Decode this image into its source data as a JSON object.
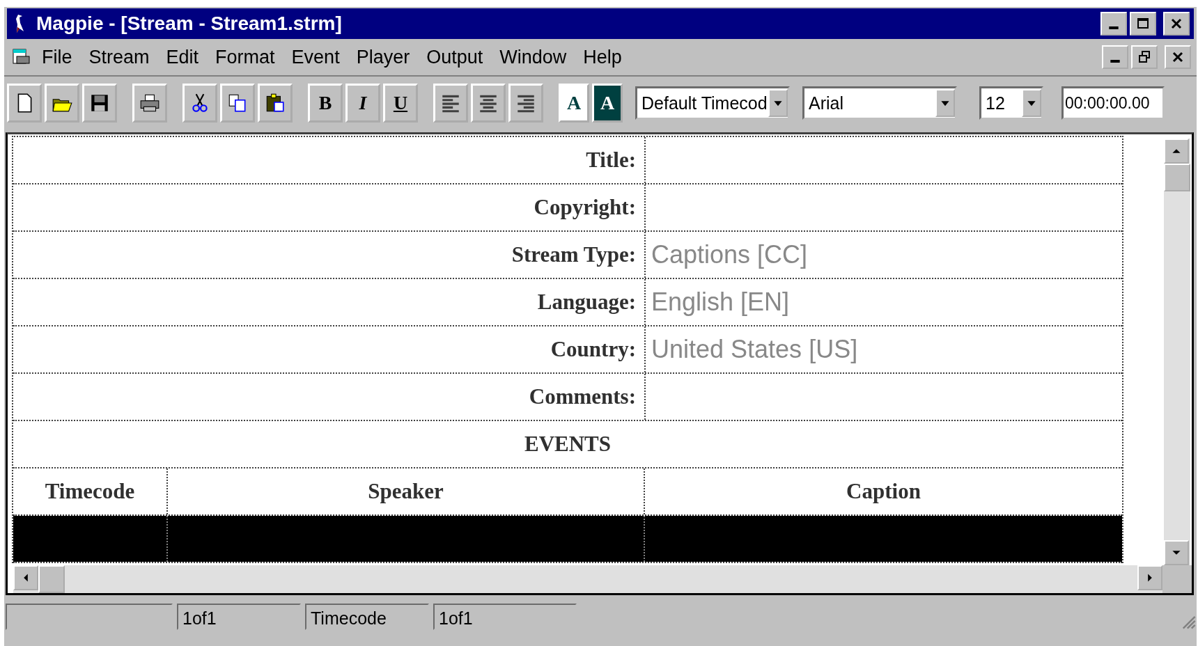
{
  "window": {
    "title": "Magpie - [Stream - Stream1.strm]"
  },
  "menu": [
    "File",
    "Stream",
    "Edit",
    "Format",
    "Event",
    "Player",
    "Output",
    "Window",
    "Help"
  ],
  "toolbar": [
    {
      "kind": "icon"
    },
    {
      "kind": "icon"
    },
    {
      "kind": "icon"
    },
    {
      "kind": "gap"
    },
    {
      "kind": "icon"
    },
    {
      "kind": "gap"
    },
    {
      "kind": "icon"
    },
    {
      "kind": "icon"
    },
    {
      "kind": "icon"
    },
    {
      "kind": "gap"
    },
    {
      "kind": "text",
      "label": "B"
    },
    {
      "kind": "text",
      "label": "I"
    },
    {
      "kind": "text",
      "label": "U"
    },
    {
      "kind": "gap"
    },
    {
      "kind": "icon"
    },
    {
      "kind": "icon"
    },
    {
      "kind": "icon"
    },
    {
      "kind": "gap"
    },
    {
      "kind": "text",
      "label": "A"
    },
    {
      "kind": "text",
      "label": "A"
    }
  ],
  "combos": [
    {
      "value": "Default Timecod"
    },
    {
      "value": "Arial"
    },
    {
      "value": "12"
    }
  ],
  "timecode_field": {
    "value": "00:00:00.00"
  },
  "fields": [
    {
      "label": "Title:"
    },
    {
      "label": "Copyright:"
    },
    {
      "label": "Stream Type:",
      "value": "Captions [CC]"
    },
    {
      "label": "Language:",
      "value": "English [EN]"
    },
    {
      "label": "Country:",
      "value": "United States [US]"
    },
    {
      "label": "Comments:"
    }
  ],
  "events": {
    "title": "EVENTS",
    "columns": [
      "Timecode",
      "Speaker",
      "Caption"
    ],
    "rows": [
      {
        "selected": true
      }
    ]
  },
  "status_bar": [
    "1of1",
    "Timecode",
    "1of1"
  ]
}
